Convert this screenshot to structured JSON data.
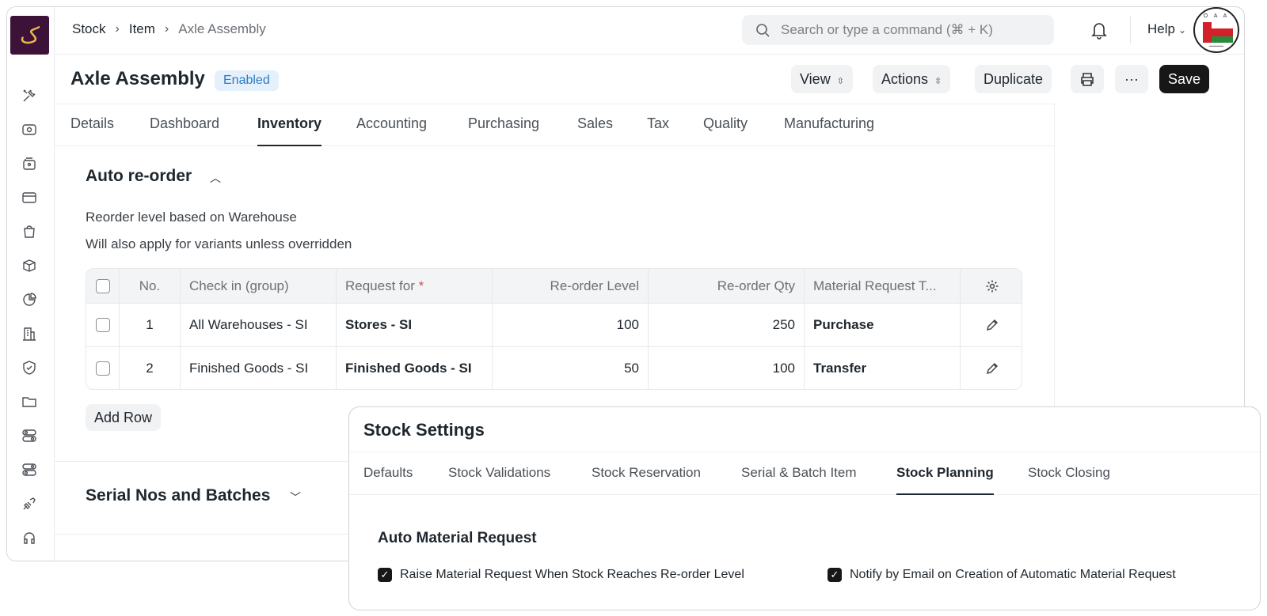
{
  "breadcrumb": [
    "Stock",
    "Item",
    "Axle Assembly"
  ],
  "search": {
    "placeholder": "Search or type a command (⌘ + K)"
  },
  "topbar": {
    "help_label": "Help"
  },
  "avatar": {
    "text": "O A A"
  },
  "doc": {
    "title": "Axle Assembly",
    "status": "Enabled",
    "view_label": "View",
    "actions_label": "Actions",
    "duplicate_label": "Duplicate",
    "more_label": "···",
    "save_label": "Save"
  },
  "tabs": [
    "Details",
    "Dashboard",
    "Inventory",
    "Accounting",
    "Purchasing",
    "Sales",
    "Tax",
    "Quality",
    "Manufacturing"
  ],
  "active_tab": "Inventory",
  "reorder": {
    "title": "Auto re-order",
    "desc1": "Reorder level based on Warehouse",
    "desc2": "Will also apply for variants unless overridden",
    "columns": [
      "No.",
      "Check in (group)",
      "Request for",
      "Re-order Level",
      "Re-order Qty",
      "Material Request T..."
    ],
    "rows": [
      {
        "no": "1",
        "check_in": "All Warehouses - SI",
        "request_for": "Stores - SI",
        "level": "100",
        "qty": "250",
        "type": "Purchase"
      },
      {
        "no": "2",
        "check_in": "Finished Goods - SI",
        "request_for": "Finished Goods - SI",
        "level": "50",
        "qty": "100",
        "type": "Transfer"
      }
    ],
    "add_row": "Add Row"
  },
  "serial_section": {
    "title": "Serial Nos and Batches"
  },
  "stock_settings": {
    "title": "Stock Settings",
    "tabs": [
      "Defaults",
      "Stock Validations",
      "Stock Reservation",
      "Serial & Batch Item",
      "Stock Planning",
      "Stock Closing"
    ],
    "active_tab": "Stock Planning",
    "section": "Auto Material Request",
    "check1": "Raise Material Request When Stock Reaches Re-order Level",
    "check2": "Notify by Email on Creation of Automatic Material Request"
  },
  "colors": {
    "logo_bg": "#3d1238",
    "badge_bg": "#e4f0fb",
    "badge_text": "#2b7bc2",
    "save_bg": "#171717"
  }
}
